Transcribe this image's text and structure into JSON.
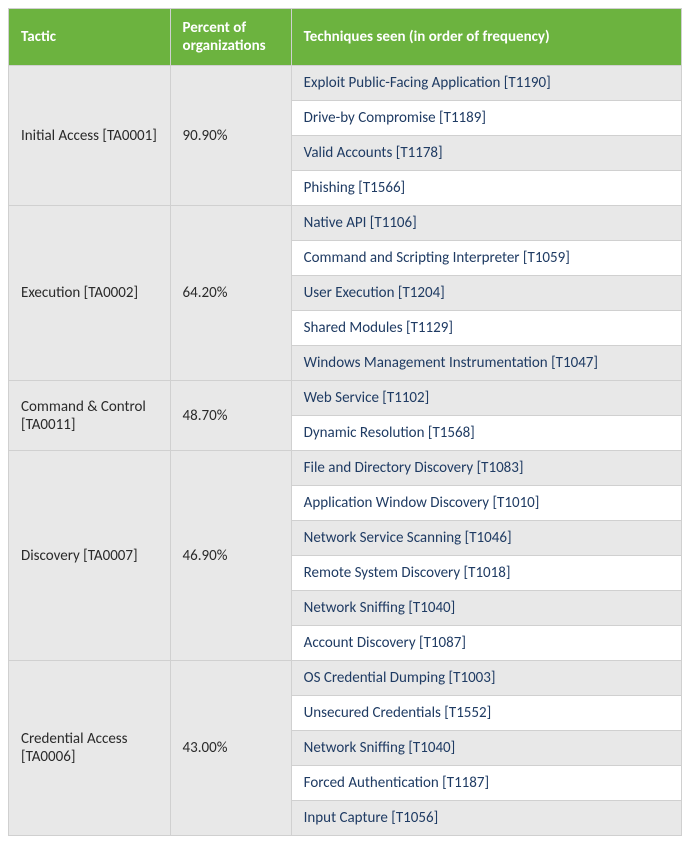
{
  "headers": {
    "tactic": "Tactic",
    "percent": "Percent of organizations",
    "techniques": "Techniques seen (in order of frequency)"
  },
  "rows": [
    {
      "tactic": "Initial Access [TA0001]",
      "percent": "90.90%",
      "techniques": [
        "Exploit Public-Facing Application [T1190]",
        "Drive-by Compromise [T1189]",
        "Valid Accounts [T1178]",
        "Phishing [T1566]"
      ]
    },
    {
      "tactic": "Execution [TA0002]",
      "percent": "64.20%",
      "techniques": [
        "Native API [T1106]",
        "Command and Scripting Interpreter [T1059]",
        "User Execution [T1204]",
        "Shared Modules [T1129]",
        "Windows Management Instrumentation [T1047]"
      ]
    },
    {
      "tactic": "Command & Control [TA0011]",
      "percent": "48.70%",
      "techniques": [
        "Web Service [T1102]",
        "Dynamic Resolution [T1568]"
      ]
    },
    {
      "tactic": "Discovery [TA0007]",
      "percent": "46.90%",
      "techniques": [
        "File and Directory Discovery [T1083]",
        "Application Window Discovery [T1010]",
        "Network Service Scanning [T1046]",
        "Remote System Discovery [T1018]",
        "Network Sniffing [T1040]",
        "Account Discovery [T1087]"
      ]
    },
    {
      "tactic": "Credential Access [TA0006]",
      "percent": "43.00%",
      "techniques": [
        "OS Credential Dumping [T1003]",
        "Unsecured Credentials [T1552]",
        "Network Sniffing [T1040]",
        "Forced Authentication [T1187]",
        "Input Capture [T1056]"
      ]
    }
  ]
}
